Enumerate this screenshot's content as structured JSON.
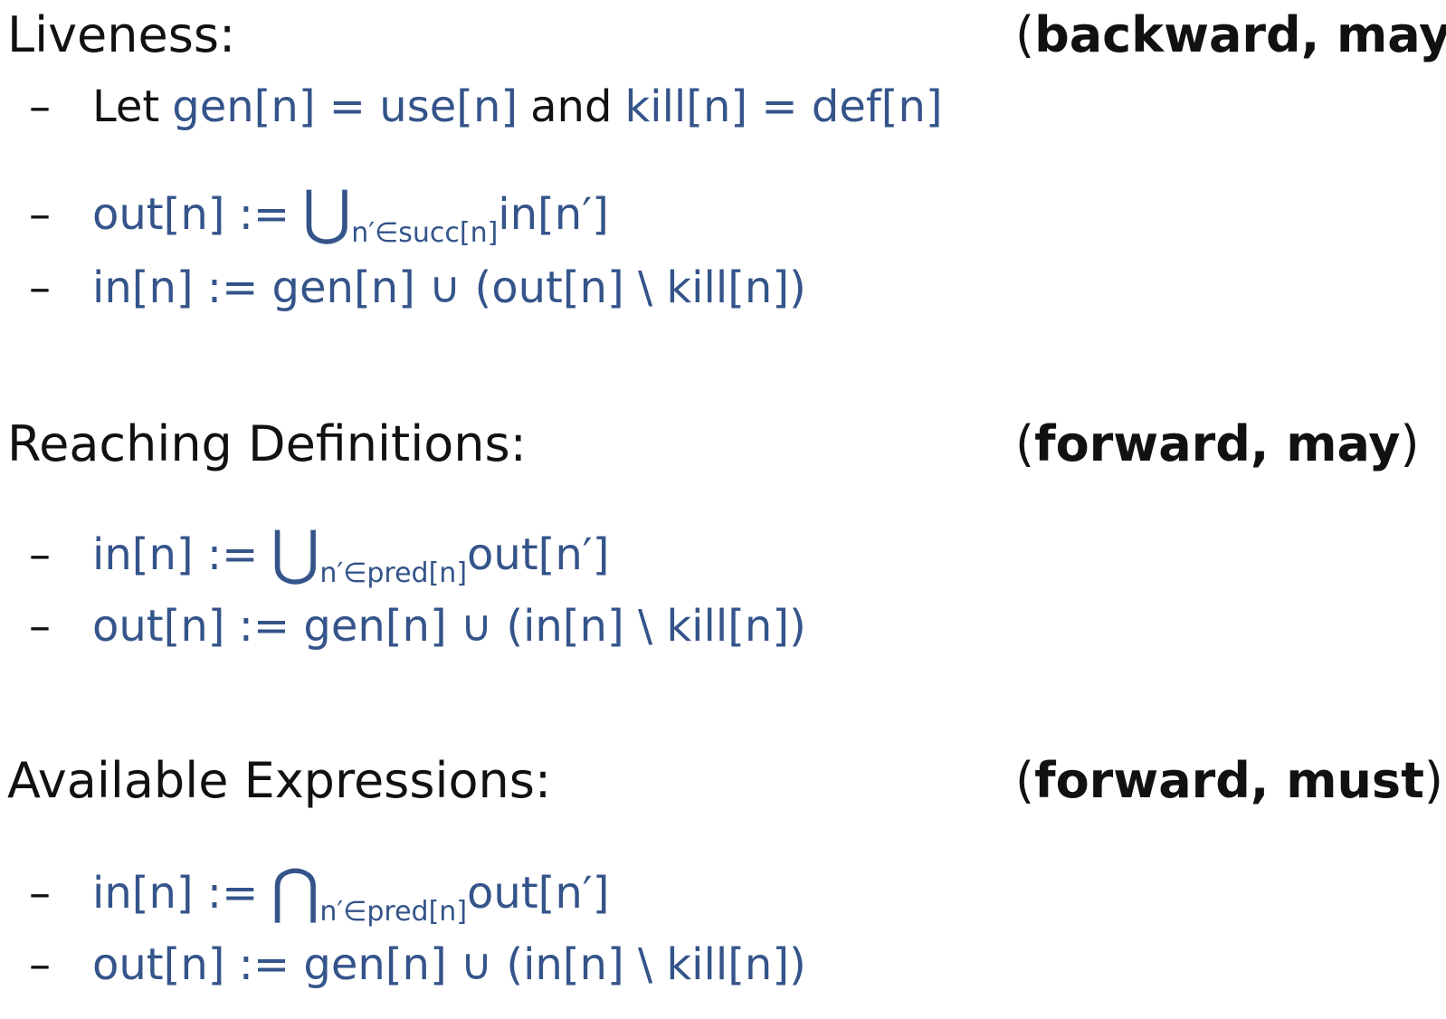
{
  "liveness": {
    "heading": "Liveness:",
    "annotation": {
      "open": "(",
      "text": "backward, may",
      "close": ")"
    },
    "items": [
      {
        "dash": "–",
        "let": "Let",
        "gen": "gen[n] = use[n]",
        "and": "and",
        "kill": "kill[n] = def[n]"
      },
      {
        "dash": "–",
        "lhs": "out[n] :=",
        "op": "⋃",
        "sub": "n′∈succ[n]",
        "rhs": "in[n′]"
      },
      {
        "dash": "–",
        "expr": "in[n] := gen[n] ∪ (out[n] \\ kill[n])"
      }
    ]
  },
  "reaching": {
    "heading": "Reaching Definitions:",
    "annotation": {
      "open": "(",
      "text": "forward, may",
      "close": ")"
    },
    "items": [
      {
        "dash": "–",
        "lhs": "in[n] :=",
        "op": "⋃",
        "sub": "n′∈pred[n]",
        "rhs": "out[n′]"
      },
      {
        "dash": "–",
        "expr": "out[n] := gen[n] ∪ (in[n] \\ kill[n])"
      }
    ]
  },
  "available": {
    "heading": "Available Expressions:",
    "annotation": {
      "open": "(",
      "text": "forward, must",
      "close": ")"
    },
    "items": [
      {
        "dash": "–",
        "lhs": "in[n] :=",
        "op": "⋂",
        "sub": "n′∈pred[n]",
        "rhs": "out[n′]"
      },
      {
        "dash": "–",
        "expr": "out[n] := gen[n] ∪ (in[n] \\ kill[n])"
      }
    ]
  },
  "colors": {
    "text": "#111111",
    "math": "#34548a",
    "background": "#ffffff"
  }
}
